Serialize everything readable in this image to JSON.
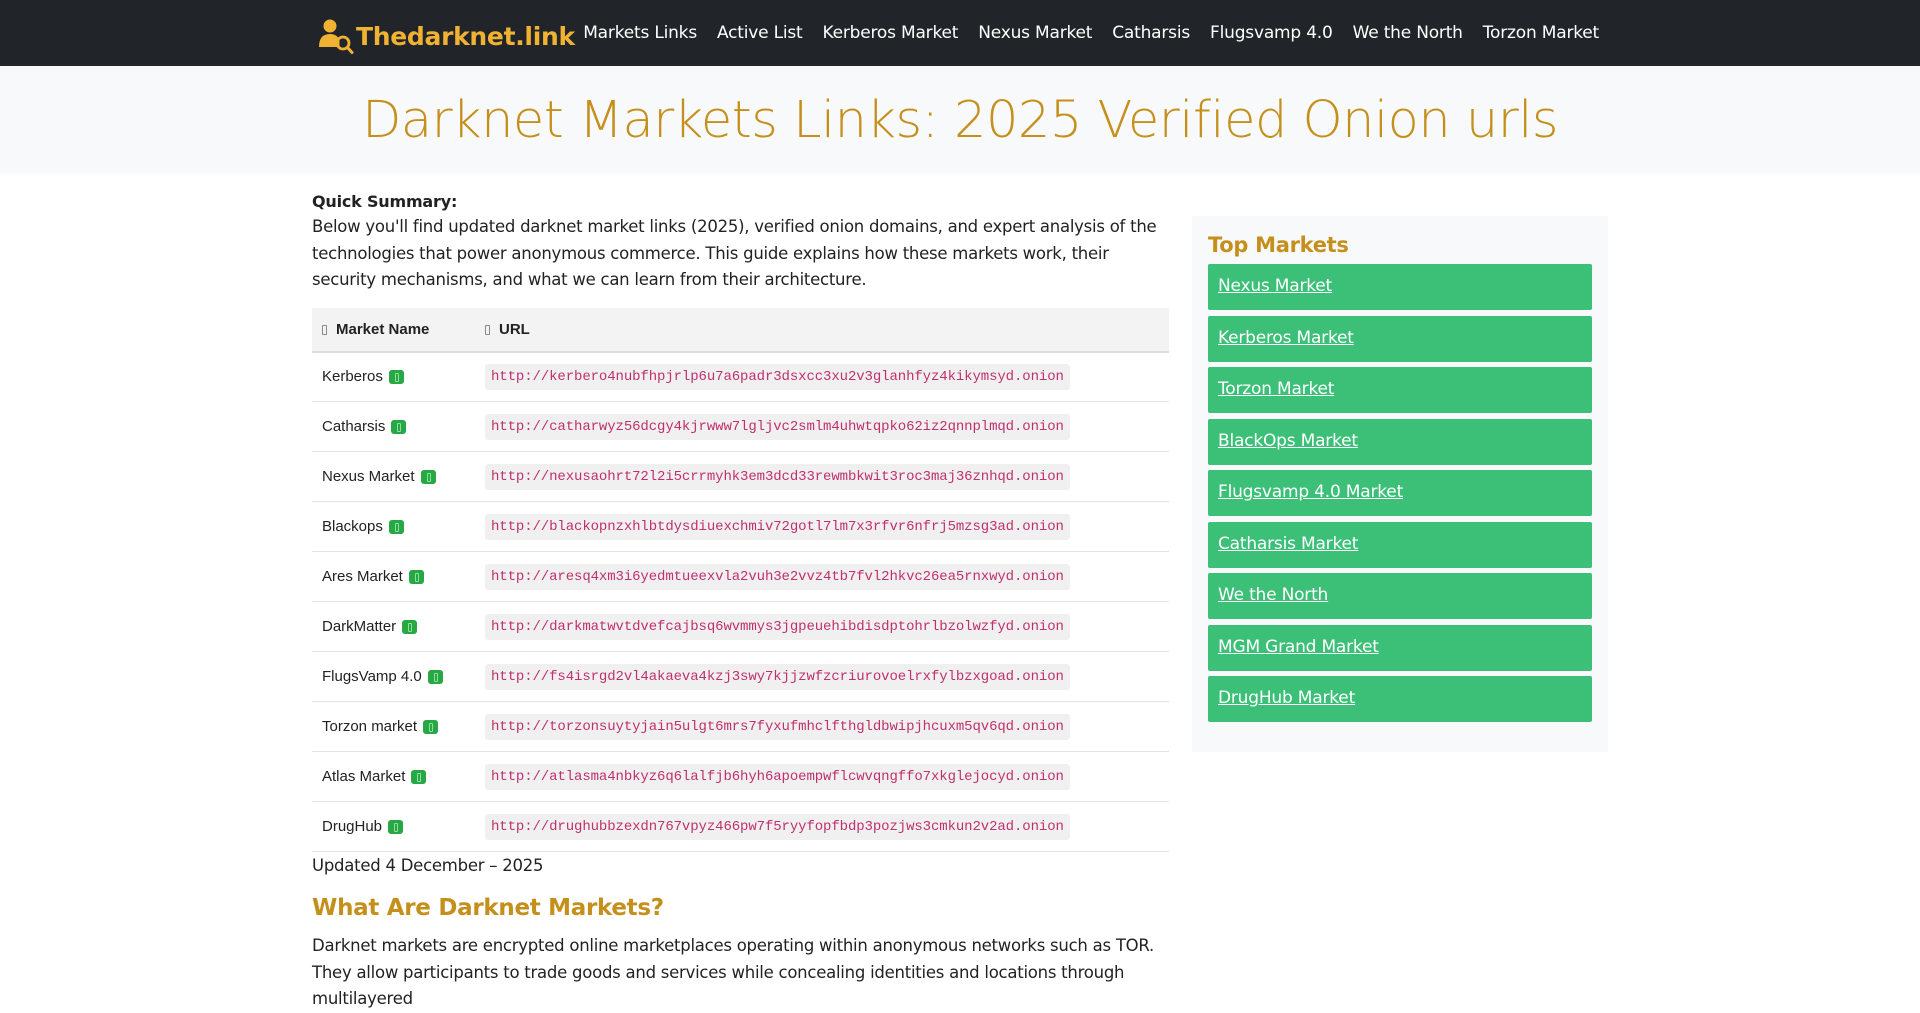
{
  "nav": {
    "brand": "Thedarknet.link",
    "links": [
      "Markets Links",
      "Active List",
      "Kerberos Market",
      "Nexus Market",
      "Catharsis",
      "Flugsvamp 4.0",
      "We the North",
      "Torzon Market"
    ]
  },
  "hero": {
    "title": "Darknet Markets Links: 2025 Verified Onion urls"
  },
  "summary": {
    "label": "Quick Summary:",
    "text": "Below you'll find updated darknet market links (2025), verified onion domains, and expert analysis of the technologies that power anonymous commerce. This guide explains how these markets work, their security mechanisms, and what we can learn from their architecture."
  },
  "table": {
    "headers": [
      "Market Name",
      "URL"
    ],
    "rows": [
      {
        "name": "Kerberos",
        "url": "http://kerbero4nubfhpjrlp6u7a6padr3dsxcc3xu2v3glanhfyz4kikymsyd.onion"
      },
      {
        "name": "Catharsis",
        "url": "http://catharwyz56dcgy4kjrwww7lgljvc2smlm4uhwtqpko62iz2qnnplmqd.onion"
      },
      {
        "name": "Nexus Market",
        "url": "http://nexusaohrt72l2i5crrmyhk3em3dcd33rewmbkwit3roc3maj36znhqd.onion"
      },
      {
        "name": "Blackops",
        "url": "http://blackopnzxhlbtdysdiuexchmiv72gotl7lm7x3rfvr6nfrj5mzsg3ad.onion"
      },
      {
        "name": "Ares Market",
        "url": "http://aresq4xm3i6yedmtueexvla2vuh3e2vvz4tb7fvl2hkvc26ea5rnxwyd.onion"
      },
      {
        "name": "DarkMatter",
        "url": "http://darkmatwvtdvefcajbsq6wvmmys3jgpeuehibdisdptohrlbzolwzfyd.onion"
      },
      {
        "name": "FlugsVamp 4.0",
        "url": "http://fs4isrgd2vl4akaeva4kzj3swy7kjjzwfzcriurovoelrxfylbzxgoad.onion"
      },
      {
        "name": "Torzon market",
        "url": "http://torzonsuytyjain5ulgt6mrs7fyxufmhclfthgldbwipjhcuxm5qv6qd.onion"
      },
      {
        "name": "Atlas Market",
        "url": "http://atlasma4nbkyz6q6lalfjb6hyh6apoempwflcwvqngffo7xkglejocyd.onion"
      },
      {
        "name": "DrugHub",
        "url": "http://drughubbzexdn767vpyz466pw7f5ryyfopfbdp3pozjws3cmkun2v2ad.onion"
      }
    ]
  },
  "updated": "Updated 4 December – 2025",
  "section": {
    "title": "What Are Darknet Markets?",
    "text": "Darknet markets are encrypted online marketplaces operating within anonymous networks such as TOR. They allow participants to trade goods and services while concealing identities and locations through multilayered"
  },
  "sidebar": {
    "title": "Top Markets",
    "links": [
      "Nexus Market",
      "Kerberos Market",
      "Torzon Market",
      "BlackOps Market",
      "Flugsvamp 4.0 Market",
      "Catharsis Market",
      "We the North",
      "MGM Grand Market",
      "DrugHub Market"
    ]
  },
  "colors": {
    "navbar": "#212529",
    "brand": "#f0b232",
    "accent": "#c58f1c",
    "sidebar_button": "#3cc078",
    "verified_badge": "#28a745",
    "url_text": "#c0306e"
  },
  "icons": {
    "brand": "user-search-icon",
    "verified": "verified-badge-icon",
    "sort": "sort-icon"
  }
}
